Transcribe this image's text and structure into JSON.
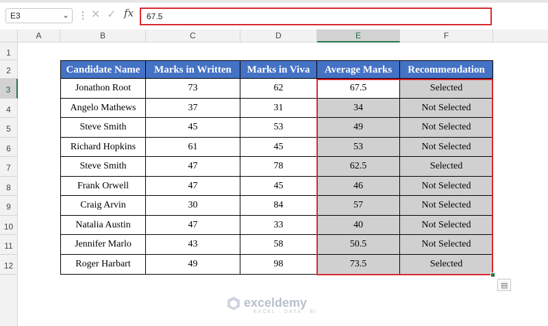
{
  "formula_bar": {
    "name_box": "E3",
    "chevron": "⌄",
    "dots": "⋮",
    "cancel": "✕",
    "enter": "✓",
    "fx": "fx",
    "formula": "67.5"
  },
  "grid": {
    "columns": [
      "A",
      "B",
      "C",
      "D",
      "E",
      "F"
    ],
    "rows": [
      "1",
      "2",
      "3",
      "4",
      "5",
      "6",
      "7",
      "8",
      "9",
      "10",
      "11",
      "12"
    ],
    "selected_column": "E",
    "selected_row": "3"
  },
  "table": {
    "headers": [
      "Candidate Name",
      "Marks in Written",
      "Marks in Viva",
      "Average Marks",
      "Recommendation"
    ],
    "rows": [
      [
        "Jonathon Root",
        "73",
        "62",
        "67.5",
        "Selected"
      ],
      [
        "Angelo Mathews",
        "37",
        "31",
        "34",
        "Not Selected"
      ],
      [
        "Steve Smith",
        "45",
        "53",
        "49",
        "Not Selected"
      ],
      [
        "Richard Hopkins",
        "61",
        "45",
        "53",
        "Not Selected"
      ],
      [
        "Steve Smith",
        "47",
        "78",
        "62.5",
        "Selected"
      ],
      [
        "Frank Orwell",
        "47",
        "45",
        "46",
        "Not Selected"
      ],
      [
        "Craig Arvin",
        "30",
        "84",
        "57",
        "Not Selected"
      ],
      [
        "Natalia Austin",
        "47",
        "33",
        "40",
        "Not Selected"
      ],
      [
        "Jennifer Marlo",
        "43",
        "58",
        "50.5",
        "Not Selected"
      ],
      [
        "Roger Harbart",
        "49",
        "98",
        "73.5",
        "Selected"
      ]
    ]
  },
  "watermark": {
    "name": "exceldemy",
    "tagline": "EXCEL · DATA · BI"
  },
  "colors": {
    "header_fill": "#4472c4",
    "highlight_fill": "#d0d0d0",
    "selection_border": "#d9262c",
    "excel_green": "#217346"
  },
  "icons": {
    "quick_analysis": "quick-analysis-icon",
    "watermark_logo": "exceldemy-logo-icon"
  }
}
